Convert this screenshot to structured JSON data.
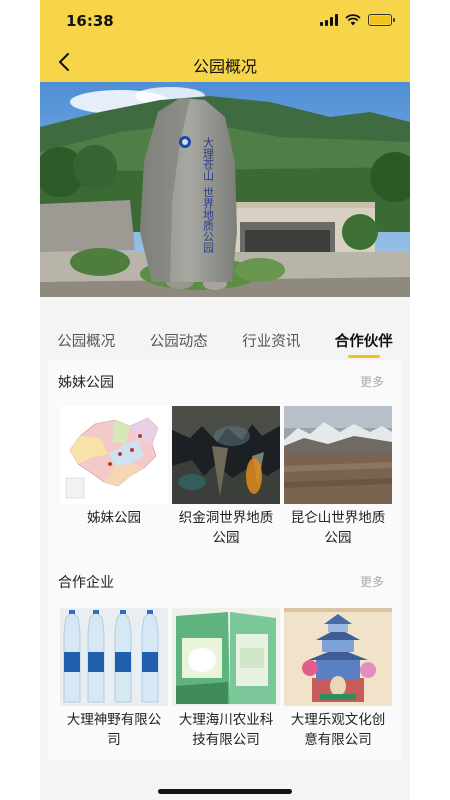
{
  "status": {
    "time": "16:38"
  },
  "nav": {
    "title": "公园概况"
  },
  "hero": {
    "stone_text": "大理苍山世界地质公园"
  },
  "tabs": [
    {
      "label": "公园概况",
      "active": false
    },
    {
      "label": "公园动态",
      "active": false
    },
    {
      "label": "行业资讯",
      "active": false
    },
    {
      "label": "合作伙伴",
      "active": true
    }
  ],
  "sister_parks": {
    "title": "姊妹公园",
    "more": "更多",
    "items": [
      {
        "label": "姊妹公园"
      },
      {
        "label": "织金洞世界地质公园"
      },
      {
        "label": "昆仑山世界地质公园"
      }
    ]
  },
  "partners": {
    "title": "合作企业",
    "more": "更多",
    "items": [
      {
        "label": "大理神野有限公司"
      },
      {
        "label": "大理海川农业科技有限公司"
      },
      {
        "label": "大理乐观文化创意有限公司"
      }
    ]
  },
  "colors": {
    "accent": "#f7d54a",
    "underline": "#f3c21a"
  }
}
